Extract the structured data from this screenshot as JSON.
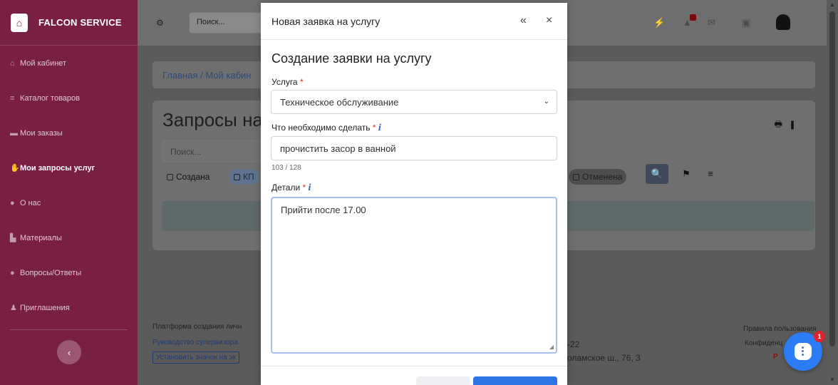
{
  "brand": {
    "name": "FALCON SERVICE"
  },
  "sidebar": {
    "items": [
      {
        "label": "Мой кабинет",
        "icon": "home-icon"
      },
      {
        "label": "Каталог товаров",
        "icon": "list-icon"
      },
      {
        "label": "Мои заказы",
        "icon": "cart-icon"
      },
      {
        "label": "Мои запросы услуг",
        "icon": "hand-icon",
        "active": true
      },
      {
        "label": "О нас",
        "icon": "info-icon"
      },
      {
        "label": "Материалы",
        "icon": "folder-icon"
      },
      {
        "label": "Вопросы/Ответы",
        "icon": "question-icon"
      },
      {
        "label": "Приглашения",
        "icon": "users-icon"
      }
    ]
  },
  "topbar": {
    "search_placeholder": "Поиск..."
  },
  "breadcrumb": {
    "text": "Главная  /  Мой кабин"
  },
  "card": {
    "title": "Запросы на",
    "search_placeholder": "Поиск...",
    "filters": [
      "Создана",
      "КП",
      "Отменена"
    ]
  },
  "footer": {
    "platform": "Платформа создания личн",
    "guide": "Руководство супервизора",
    "install": "Установить значок на эк",
    "phone_part": "-22",
    "address_part": "оламское ш., 76, 3",
    "rules": "Правила пользования",
    "privacy": "Конфиденц",
    "pdf_fragment": "P"
  },
  "chat": {
    "badge": "1"
  },
  "modal": {
    "title": "Новая заявка на услугу",
    "heading": "Создание заявки на услугу",
    "service_label": "Услуга",
    "service_value": "Техническое обслуживание",
    "todo_label": "Что необходимо сделать",
    "todo_value": "прочистить засор в ванной",
    "counter": "103 / 128",
    "details_label": "Детали",
    "details_value": "Прийти после 17.00"
  },
  "colors": {
    "sidebar": "#7a1f44",
    "primary": "#2e74e6",
    "required": "#e0292b",
    "chat_fab": "#2b7cf6"
  }
}
